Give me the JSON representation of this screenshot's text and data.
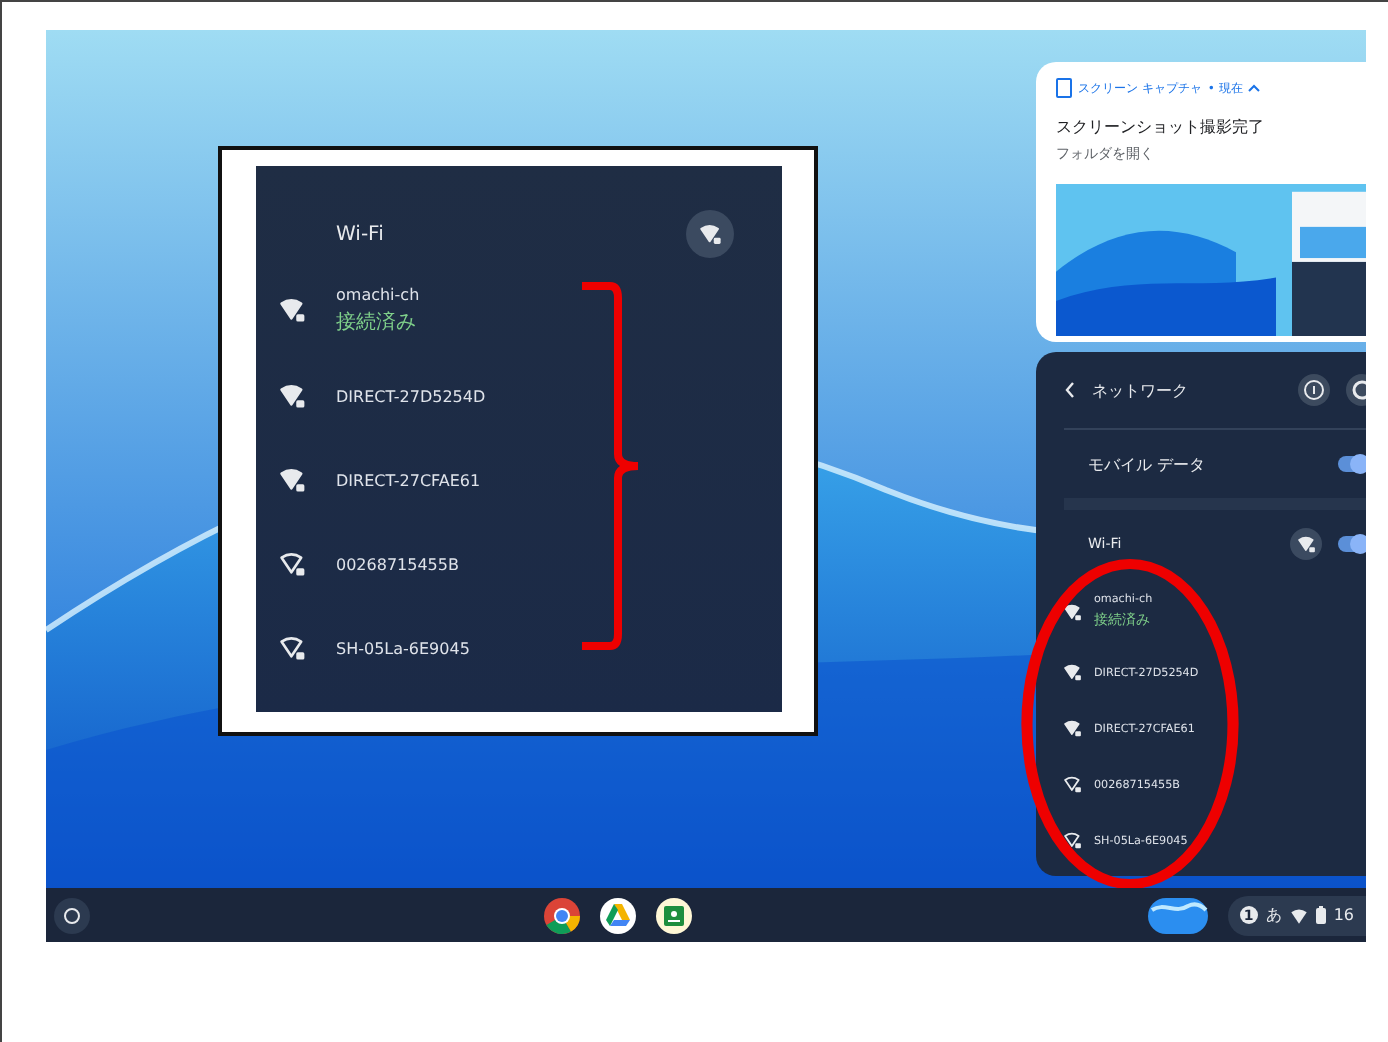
{
  "inset": {
    "title": "Wi-Fi",
    "networks": [
      {
        "name": "omachi-ch",
        "status": "接続済み",
        "kind": "full"
      },
      {
        "name": "DIRECT-27D5254D",
        "kind": "full"
      },
      {
        "name": "DIRECT-27CFAE61",
        "kind": "full"
      },
      {
        "name": "00268715455B",
        "kind": "weak"
      },
      {
        "name": "SH-05La-6E9045",
        "kind": "weak"
      }
    ]
  },
  "notification": {
    "app": "スクリーン キャプチャ",
    "time": "• 現在",
    "title": "スクリーンショット撮影完了",
    "action": "フォルダを開く"
  },
  "network_panel": {
    "title": "ネットワーク",
    "mobile_data": {
      "label": "モバイル データ",
      "on": true
    },
    "wifi": {
      "label": "Wi-Fi",
      "on": true
    },
    "networks": [
      {
        "name": "omachi-ch",
        "status": "接続済み",
        "kind": "full"
      },
      {
        "name": "DIRECT-27D5254D",
        "kind": "full"
      },
      {
        "name": "DIRECT-27CFAE61",
        "kind": "full"
      },
      {
        "name": "00268715455B",
        "kind": "weak"
      },
      {
        "name": "SH-05La-6E9045",
        "kind": "weak"
      }
    ]
  },
  "tray": {
    "badge": "1",
    "ime": "あ",
    "time": "16"
  }
}
